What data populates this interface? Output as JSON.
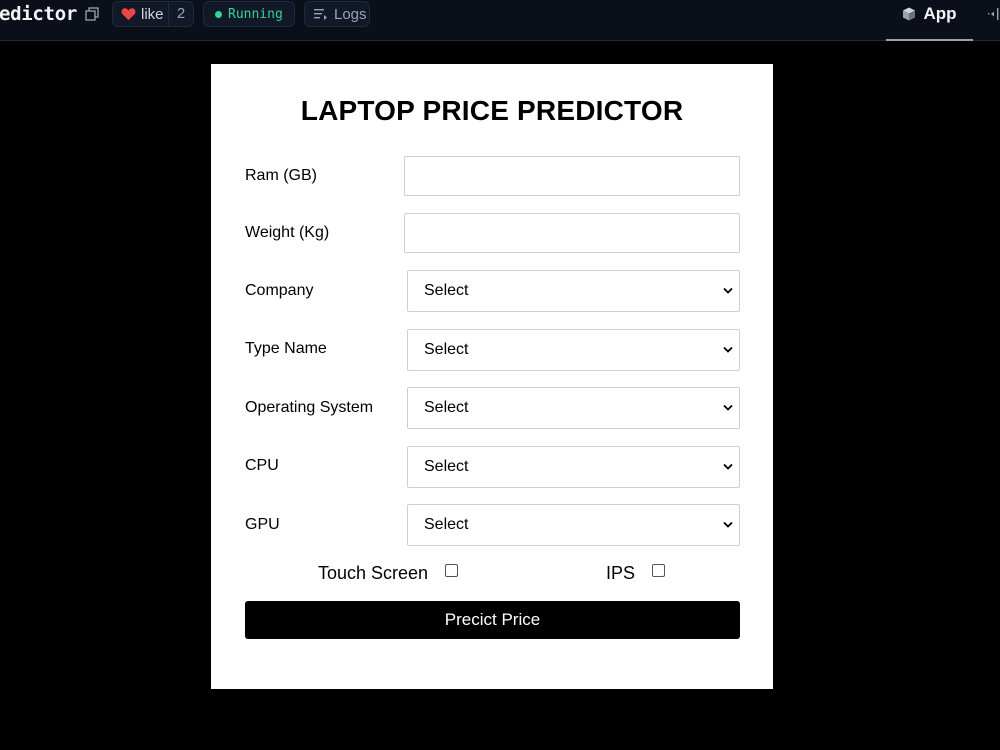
{
  "topbar": {
    "title": "edictor",
    "like_label": "like",
    "like_count": "2",
    "status": "Running",
    "logs_label": "Logs",
    "app_tab_label": "App"
  },
  "form": {
    "title": "LAPTOP PRICE PREDICTOR",
    "fields": {
      "ram_label": "Ram (GB)",
      "ram_value": "",
      "weight_label": "Weight (Kg)",
      "weight_value": "",
      "company_label": "Company",
      "company_value": "Select",
      "type_label": "Type Name",
      "type_value": "Select",
      "os_label": "Operating System",
      "os_value": "Select",
      "cpu_label": "CPU",
      "cpu_value": "Select",
      "gpu_label": "GPU",
      "gpu_value": "Select"
    },
    "checkboxes": {
      "touch_label": "Touch Screen",
      "ips_label": "IPS"
    },
    "submit_label": "Precict Price"
  },
  "colors": {
    "page_bg": "#000000",
    "topbar_bg": "#0b0f19",
    "running": "#34d399",
    "heart": "#ef4444",
    "card_bg": "#ffffff",
    "button_bg": "#000000"
  }
}
